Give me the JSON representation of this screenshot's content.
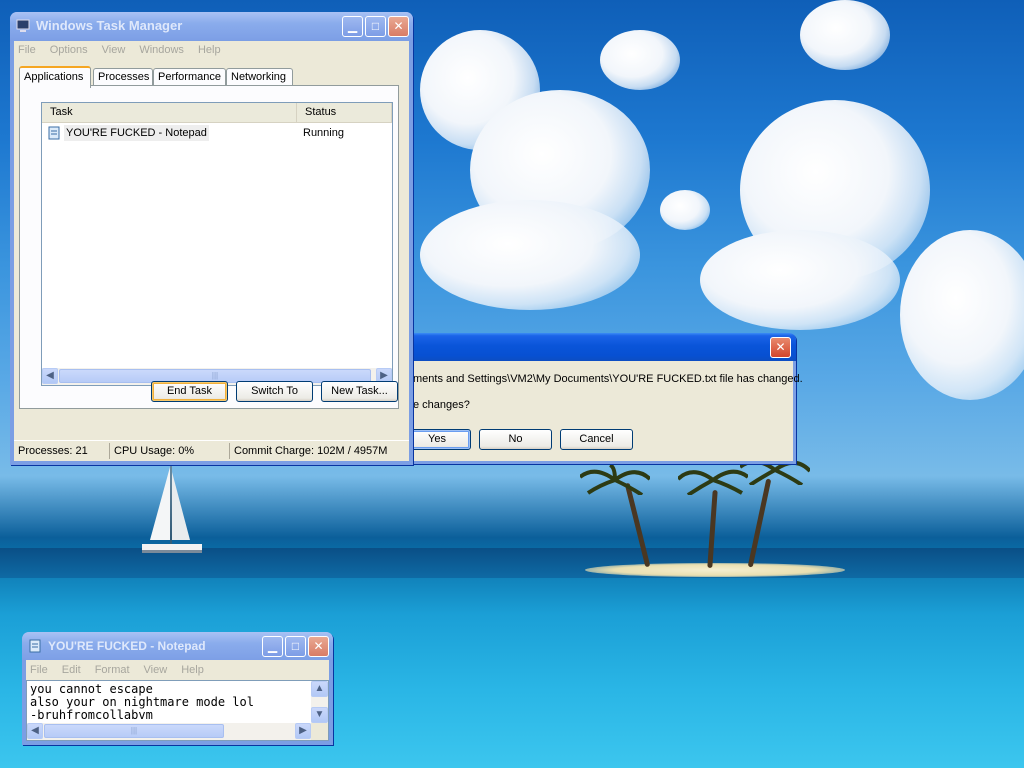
{
  "taskmgr": {
    "title": "Windows Task Manager",
    "menu": [
      "File",
      "Options",
      "View",
      "Windows",
      "Help"
    ],
    "tabs": [
      "Applications",
      "Processes",
      "Performance",
      "Networking"
    ],
    "active_tab": "Applications",
    "columns": [
      "Task",
      "Status"
    ],
    "rows": [
      {
        "task": "YOU'RE FUCKED - Notepad",
        "status": "Running"
      }
    ],
    "buttons": {
      "end_task": "End Task",
      "switch_to": "Switch To",
      "new_task": "New Task..."
    },
    "status": {
      "processes": "Processes: 21",
      "cpu": "CPU Usage: 0%",
      "commit": "Commit Charge: 102M / 4957M"
    }
  },
  "dialog": {
    "message_line1": "ments and Settings\\VM2\\My Documents\\YOU'RE FUCKED.txt file has changed.",
    "message_line2": "e changes?",
    "buttons": {
      "yes": "Yes",
      "no": "No",
      "cancel": "Cancel"
    }
  },
  "notepad": {
    "title": "YOU'RE FUCKED - Notepad",
    "menu": [
      "File",
      "Edit",
      "Format",
      "View",
      "Help"
    ],
    "content": "you cannot escape\nalso your on nightmare mode lol\n-bruhfromcollabvm"
  },
  "colors": {
    "xp_title_blue": "#0a55d9",
    "xp_close_red": "#d5452a",
    "xp_face": "#ece9d8"
  }
}
